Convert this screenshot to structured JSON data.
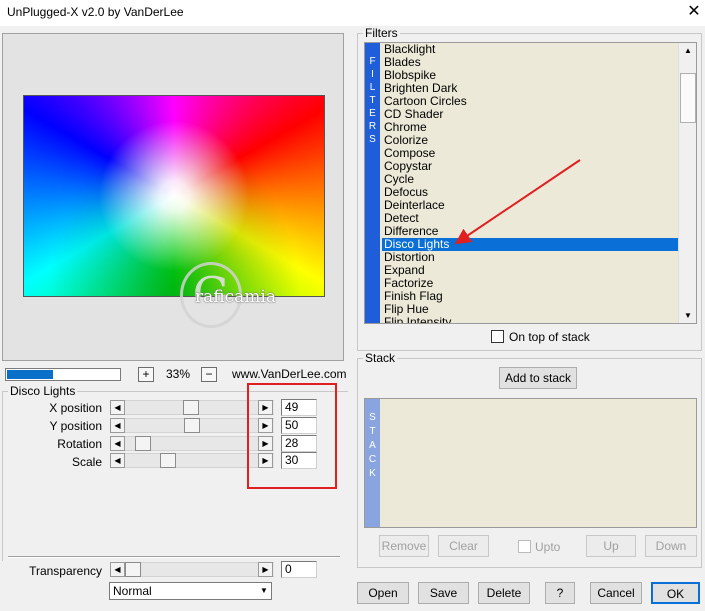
{
  "window": {
    "title": "UnPlugged-X v2.0 by VanDerLee",
    "close_glyph": "✕"
  },
  "preview": {
    "watermark_letter": "G",
    "watermark_text": "raficamia"
  },
  "zoom": {
    "plus": "+",
    "minus": "−",
    "level": "33%",
    "progress_percent": 40
  },
  "website": "www.VanDerLee.com",
  "params": {
    "group_label": "Disco Lights",
    "items": [
      {
        "label": "X position",
        "value": "49"
      },
      {
        "label": "Y position",
        "value": "50"
      },
      {
        "label": "Rotation",
        "value": "28"
      },
      {
        "label": "Scale",
        "value": "30"
      }
    ]
  },
  "transparency": {
    "label": "Transparency",
    "value": "0"
  },
  "blend": {
    "selected": "Normal"
  },
  "filters": {
    "group_label": "Filters",
    "band_letters": [
      "F",
      "I",
      "L",
      "T",
      "E",
      "R",
      "S"
    ],
    "items": [
      "Blacklight",
      "Blades",
      "Blobspike",
      "Brighten Dark",
      "Cartoon Circles",
      "CD Shader",
      "Chrome",
      "Colorize",
      "Compose",
      "Copystar",
      "Cycle",
      "Defocus",
      "Deinterlace",
      "Detect",
      "Difference",
      "Disco Lights",
      "Distortion",
      "Expand",
      "Factorize",
      "Finish Flag",
      "Flip Hue",
      "Flip Intensity"
    ],
    "selected": "Disco Lights",
    "on_top_label": "On top of stack"
  },
  "stack": {
    "group_label": "Stack",
    "add_label": "Add to stack",
    "band_letters": [
      "S",
      "T",
      "A",
      "C",
      "K"
    ],
    "remove_label": "Remove",
    "clear_label": "Clear",
    "upto_label": "Upto",
    "up_label": "Up",
    "down_label": "Down"
  },
  "footer": {
    "open": "Open",
    "save": "Save",
    "delete": "Delete",
    "help": "?",
    "cancel": "Cancel",
    "ok": "OK"
  },
  "colors": {
    "selection": "#0a6fd6",
    "filters_band": "#1f5ed8",
    "stack_band": "#8aa4e0",
    "annotation": "#e02020"
  }
}
